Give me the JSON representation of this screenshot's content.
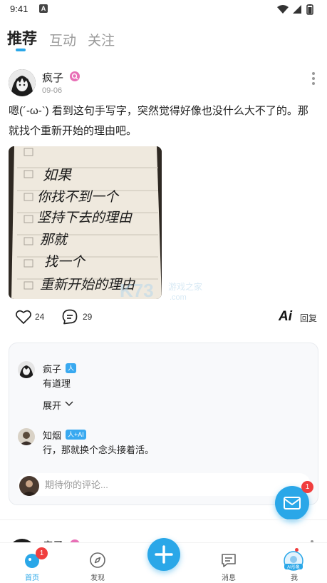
{
  "status_bar": {
    "time": "9:41",
    "app_icon": "A"
  },
  "tabs": [
    {
      "label": "推荐",
      "active": true
    },
    {
      "label": "互动",
      "active": false
    },
    {
      "label": "关注",
      "active": false
    }
  ],
  "post": {
    "author": "疯子",
    "date": "09-06",
    "text": "嗯(´-ω-`) 看到这句手写字，突然觉得好像也没什么大不了的。那就找个重新开始的理由吧。",
    "image_lines": [
      "如果",
      "你找不到一个",
      "坚持下去的理由",
      "那就",
      "找一个",
      "重新开始的理由"
    ],
    "likes": "24",
    "comments": "29",
    "ai_label": "Ai",
    "reply_label": "回复"
  },
  "comments": [
    {
      "name": "疯子",
      "badge": "人",
      "text": "有道理"
    },
    {
      "name": "知烟",
      "badge": "人+AI",
      "text": "行，那就换个念头接着活。"
    }
  ],
  "expand_label": "展开",
  "comment_input": {
    "placeholder": "期待你的评论..."
  },
  "watermark": {
    "brand": "K73",
    "text": "游戏之家",
    "domain": ".com"
  },
  "fab_badge": "1",
  "next_post_author": "疯子",
  "bottom_nav": [
    {
      "label": "首页",
      "active": true,
      "badge": "1"
    },
    {
      "label": "发现",
      "active": false
    },
    {
      "label": "",
      "active": false
    },
    {
      "label": "消息",
      "active": false
    },
    {
      "label": "我",
      "active": false,
      "icon_text": "AI形象"
    }
  ],
  "colors": {
    "accent": "#2aa7e8",
    "badge_red": "#f03e3e",
    "author_badge": "#e86fb6"
  }
}
